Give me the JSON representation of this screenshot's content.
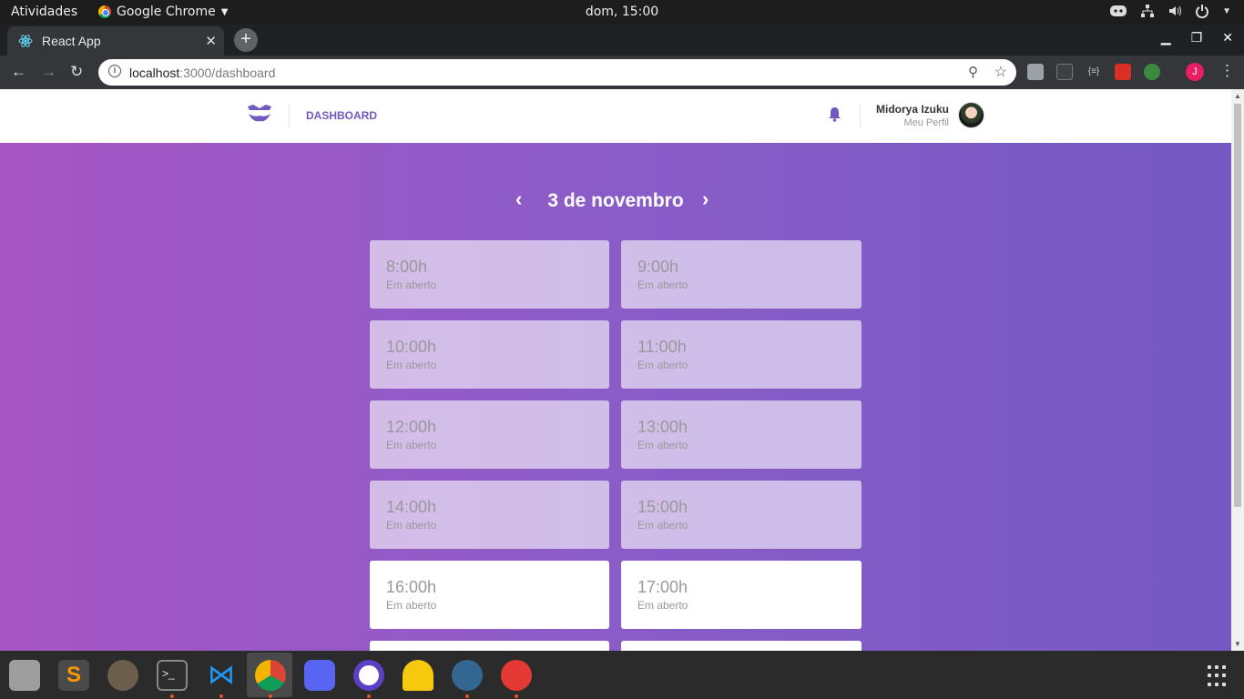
{
  "system": {
    "activities": "Atividades",
    "app_name": "Google Chrome",
    "clock": "dom, 15:00"
  },
  "browser": {
    "tab_title": "React App",
    "url_host": "localhost",
    "url_path": ":3000/dashboard",
    "profile_initial": "J"
  },
  "header": {
    "nav_label": "DASHBOARD",
    "user_name": "Midorya Izuku",
    "profile_link": "Meu Perfil"
  },
  "schedule": {
    "date_label": "3 de novembro",
    "slots": [
      {
        "time": "8:00h",
        "status": "Em aberto",
        "past": true
      },
      {
        "time": "9:00h",
        "status": "Em aberto",
        "past": true
      },
      {
        "time": "10:00h",
        "status": "Em aberto",
        "past": true
      },
      {
        "time": "11:00h",
        "status": "Em aberto",
        "past": true
      },
      {
        "time": "12:00h",
        "status": "Em aberto",
        "past": true
      },
      {
        "time": "13:00h",
        "status": "Em aberto",
        "past": true
      },
      {
        "time": "14:00h",
        "status": "Em aberto",
        "past": true
      },
      {
        "time": "15:00h",
        "status": "Em aberto",
        "past": true
      },
      {
        "time": "16:00h",
        "status": "Em aberto",
        "past": false
      },
      {
        "time": "17:00h",
        "status": "Em aberto",
        "past": false
      },
      {
        "time": "",
        "status": "",
        "past": false
      },
      {
        "time": "",
        "status": "",
        "past": false
      }
    ]
  },
  "colors": {
    "brand": "#7159c1",
    "gradient_start": "#a655c4",
    "gradient_end": "#7559c3"
  }
}
